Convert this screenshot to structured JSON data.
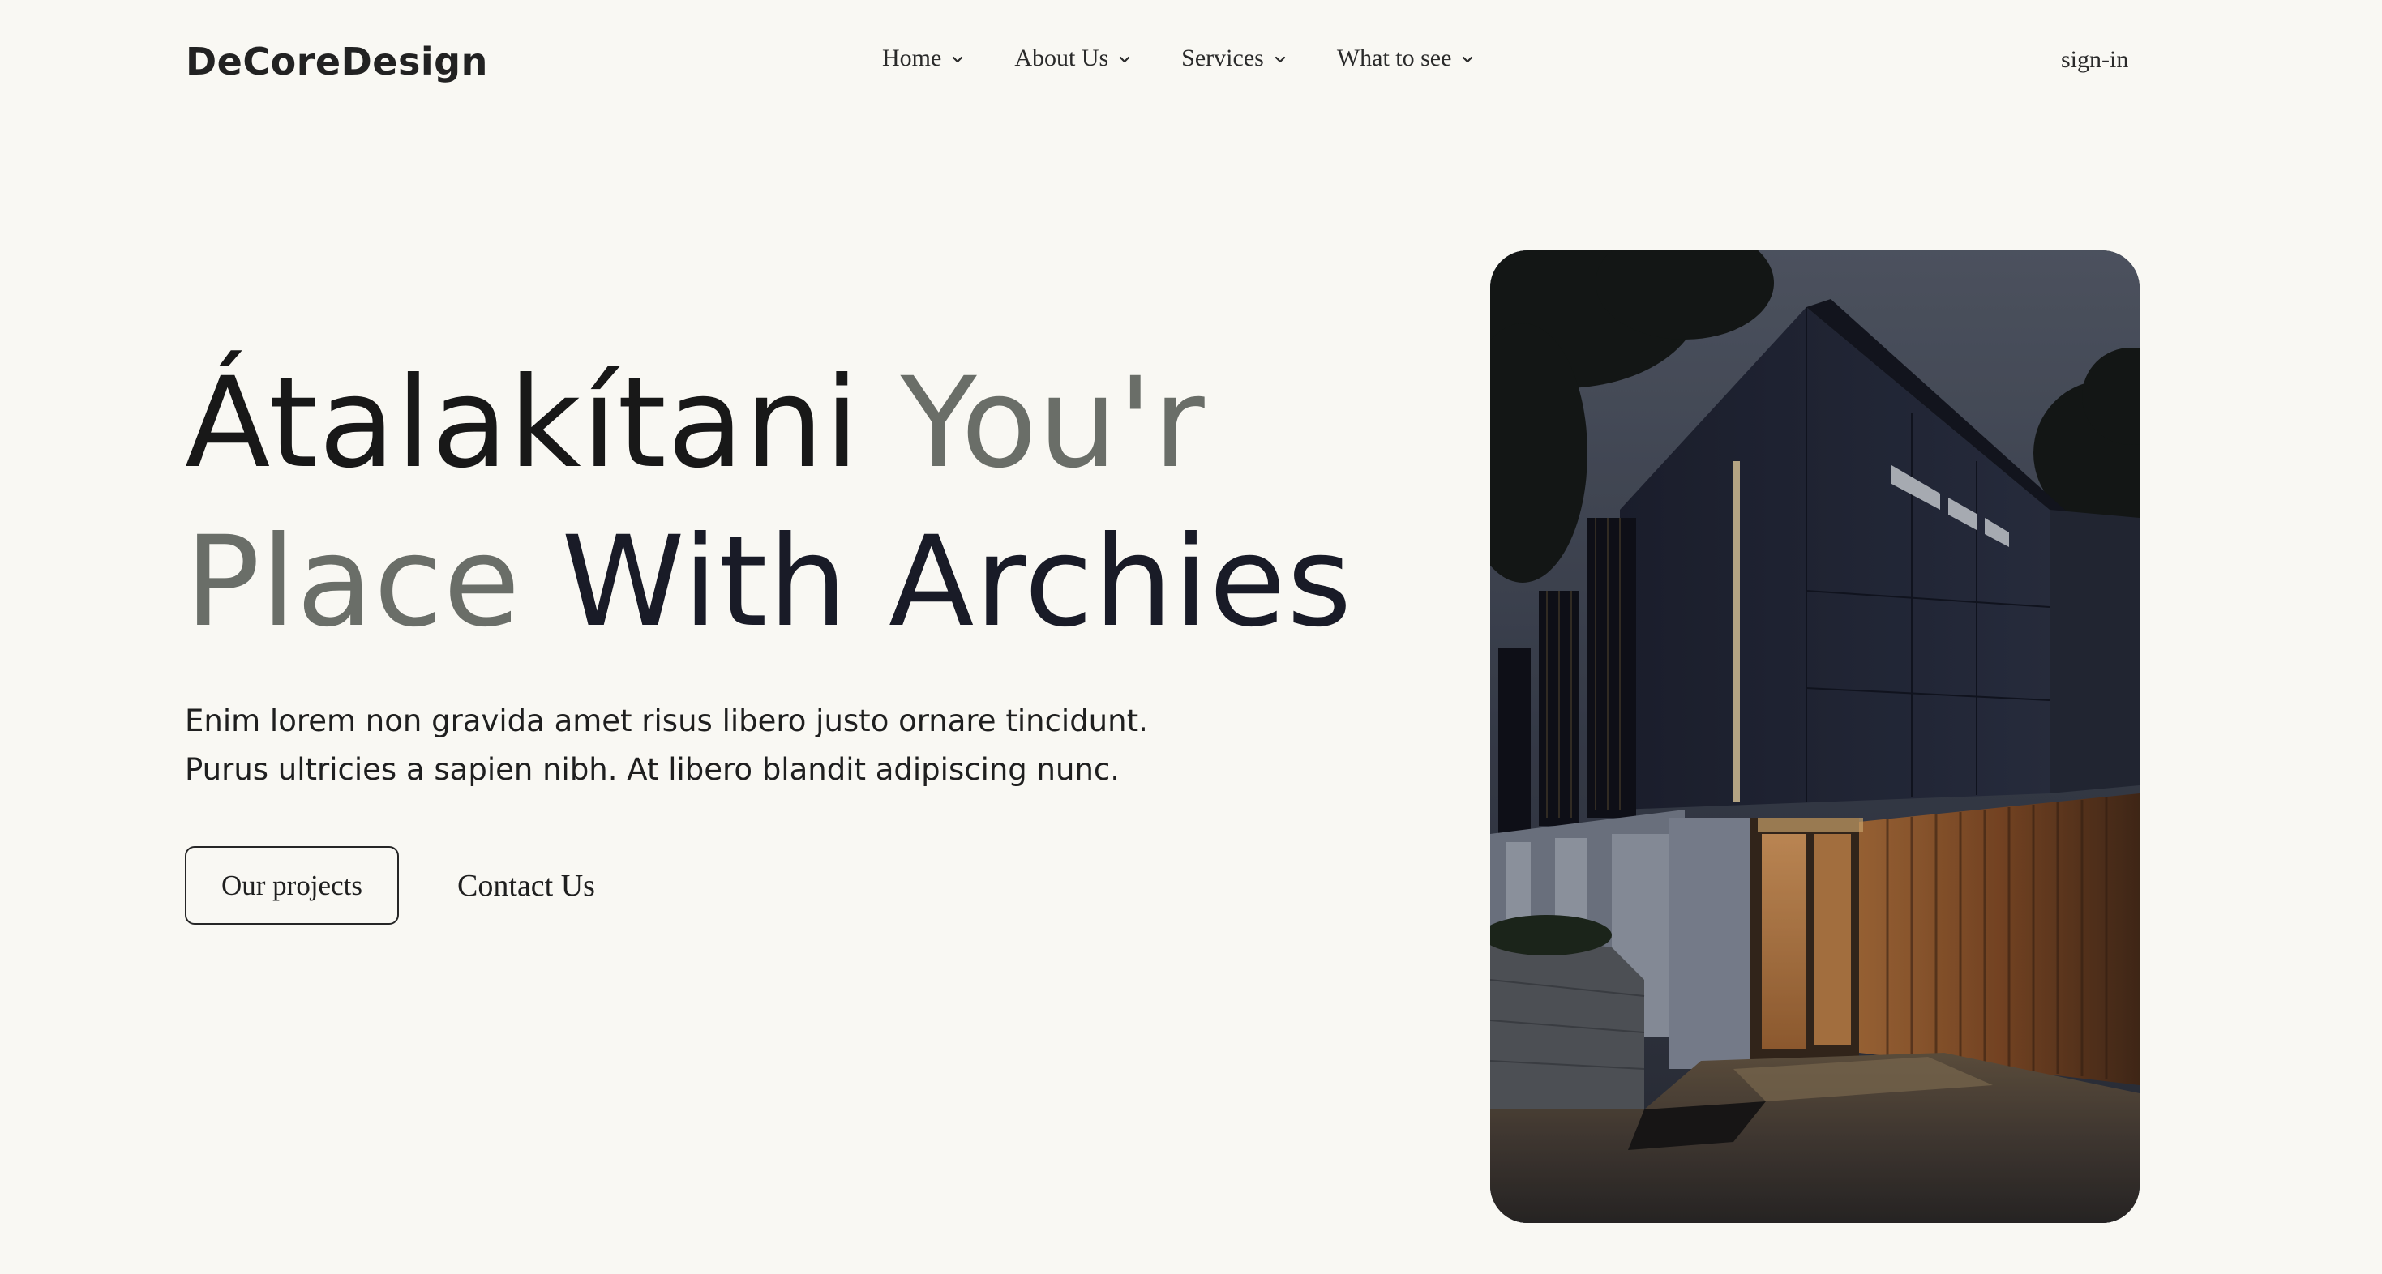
{
  "brand": {
    "logo_text": "DeCoreDesign"
  },
  "nav": {
    "items": [
      {
        "label": "Home",
        "icon": "chevron-down-icon"
      },
      {
        "label": "About Us",
        "icon": "chevron-down-icon"
      },
      {
        "label": "Services",
        "icon": "chevron-down-icon"
      },
      {
        "label": "What to see",
        "icon": "chevron-down-icon"
      }
    ],
    "signin_label": "sign-in"
  },
  "hero": {
    "headline": {
      "part1": "Átalakítani",
      "part2": "You'r",
      "part3": "Place",
      "part4": "With Archies"
    },
    "description": {
      "line1": "Enim lorem non gravida amet risus libero justo ornare tincidunt.",
      "line2": "Purus ultricies a sapien nibh. At libero blandit adipiscing nunc."
    },
    "primary_button": "Our projects",
    "secondary_button": "Contact Us",
    "image_subject": "modern dark house at dusk"
  },
  "colors": {
    "background": "#f9f8f3",
    "text_dark": "#181818",
    "text_grey": "#6a6e68",
    "text_navy": "#191b27"
  }
}
